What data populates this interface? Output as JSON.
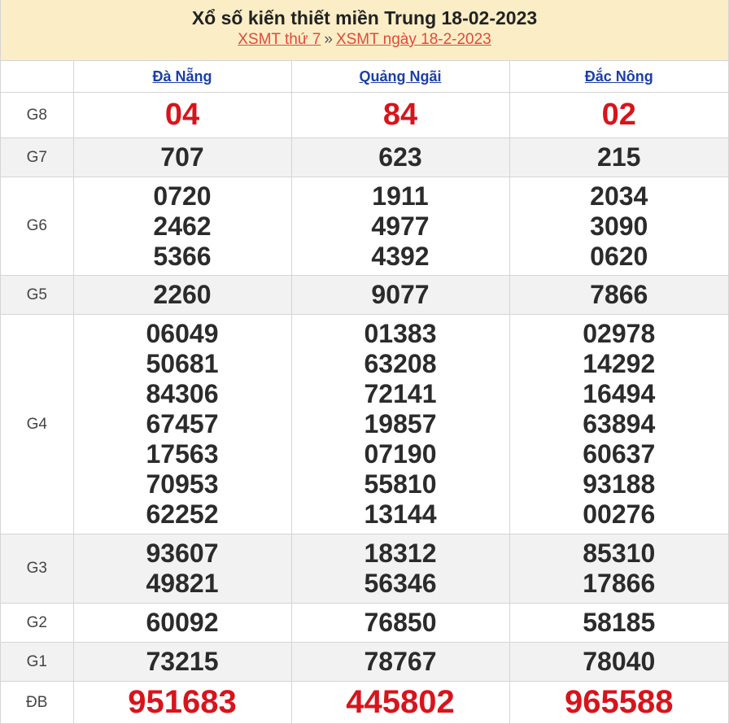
{
  "header": {
    "title": "Xổ số kiến thiết miền Trung 18-02-2023",
    "link1": "XSMT thứ 7",
    "separator": "»",
    "link2": "XSMT ngày 18-2-2023"
  },
  "provinces": [
    "Đà Nẵng",
    "Quảng Ngãi",
    "Đắc Nông"
  ],
  "prizes": {
    "g8": {
      "label": "G8",
      "values": [
        "04",
        "84",
        "02"
      ]
    },
    "g7": {
      "label": "G7",
      "values": [
        "707",
        "623",
        "215"
      ]
    },
    "g6": {
      "label": "G6",
      "values": [
        [
          "0720",
          "2462",
          "5366"
        ],
        [
          "1911",
          "4977",
          "4392"
        ],
        [
          "2034",
          "3090",
          "0620"
        ]
      ]
    },
    "g5": {
      "label": "G5",
      "values": [
        "2260",
        "9077",
        "7866"
      ]
    },
    "g4": {
      "label": "G4",
      "values": [
        [
          "06049",
          "50681",
          "84306",
          "67457",
          "17563",
          "70953",
          "62252"
        ],
        [
          "01383",
          "63208",
          "72141",
          "19857",
          "07190",
          "55810",
          "13144"
        ],
        [
          "02978",
          "14292",
          "16494",
          "63894",
          "60637",
          "93188",
          "00276"
        ]
      ]
    },
    "g3": {
      "label": "G3",
      "values": [
        [
          "93607",
          "49821"
        ],
        [
          "18312",
          "56346"
        ],
        [
          "85310",
          "17866"
        ]
      ]
    },
    "g2": {
      "label": "G2",
      "values": [
        "60092",
        "76850",
        "58185"
      ]
    },
    "g1": {
      "label": "G1",
      "values": [
        "73215",
        "78767",
        "78040"
      ]
    },
    "db": {
      "label": "ĐB",
      "values": [
        "951683",
        "445802",
        "965588"
      ]
    }
  },
  "colors": {
    "header_bg": "#fbeec6",
    "link": "#e04a3b",
    "province_link": "#1b3fa8",
    "special_red": "#d8141b"
  }
}
